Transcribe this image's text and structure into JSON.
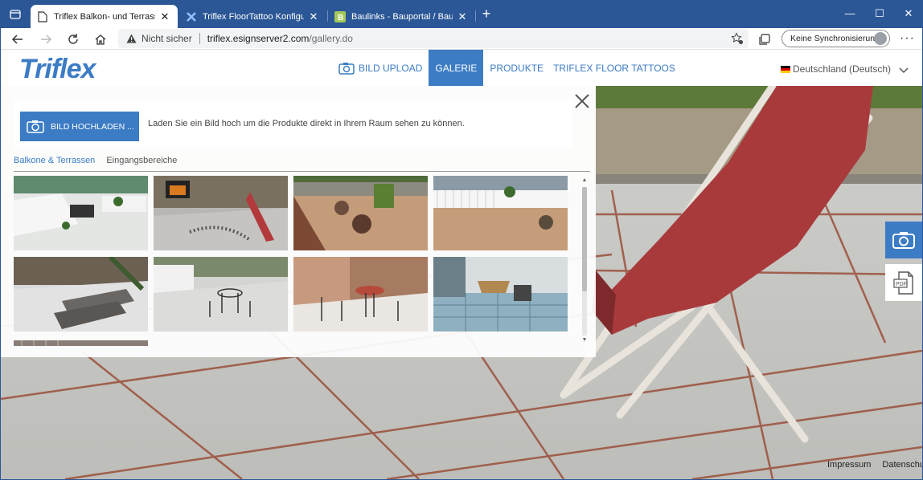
{
  "browser": {
    "tabs": [
      {
        "title": "Triflex Balkon- und Terrassen-Stu",
        "active": true
      },
      {
        "title": "Triflex FloorTattoo Konfigurator |",
        "active": false
      },
      {
        "title": "Baulinks - Bauportal / Baumagaz",
        "active": false
      }
    ],
    "address": {
      "security_label": "Nicht sicher",
      "host": "triflex.esignserver2.com",
      "path": "/gallery.do"
    },
    "sync_label": "Keine Synchronisierung",
    "more_label": "···"
  },
  "site": {
    "logo": "Triflex",
    "nav": [
      {
        "label": "BILD UPLOAD",
        "active": false
      },
      {
        "label": "GALERIE",
        "active": true
      },
      {
        "label": "PRODUKTE",
        "active": false
      },
      {
        "label": "TRIFLEX FLOOR TATTOOS",
        "active": false
      }
    ],
    "language": "Deutschland (Deutsch)"
  },
  "gallery": {
    "upload_button": "BILD HOCHLADEN ...",
    "upload_hint": "Laden Sie ein Bild hoch um die Produkte direkt in Ihrem Raum sehen zu können.",
    "categories": [
      {
        "label": "Balkone & Terrassen",
        "active": true
      },
      {
        "label": "Eingangsbereiche",
        "active": false
      }
    ]
  },
  "footer": {
    "impressum": "Impressum",
    "datenschutz": "Datenschutz"
  },
  "colors": {
    "brand": "#3c7cc4",
    "browser_frame": "#2b5797"
  }
}
